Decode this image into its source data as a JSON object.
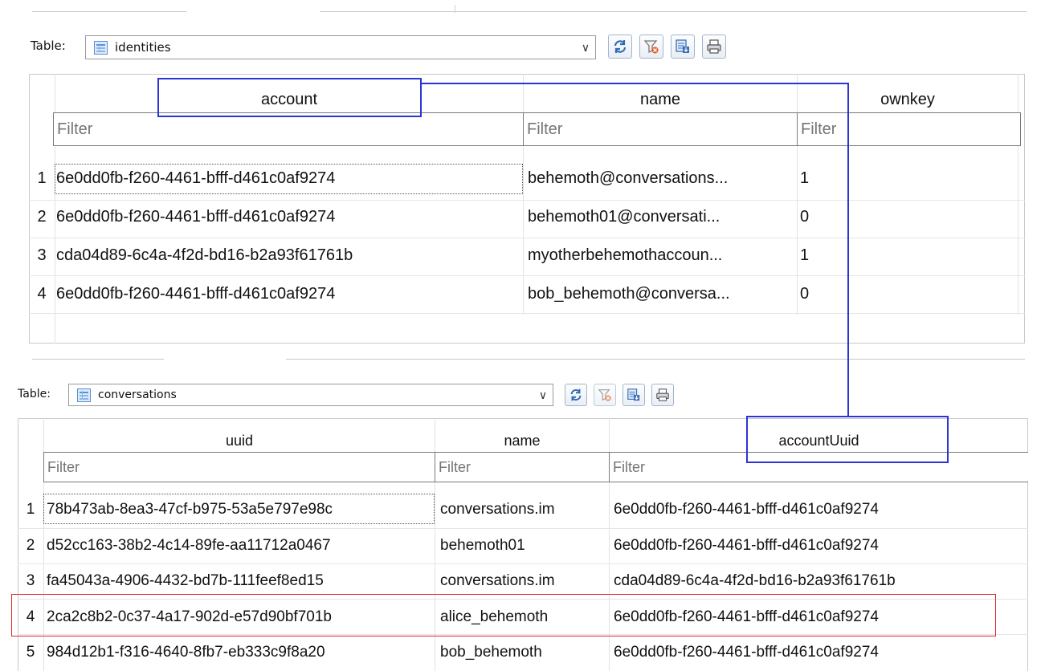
{
  "toolbar_label": "Table:",
  "identities": {
    "table_name": "identities",
    "columns": [
      "account",
      "name",
      "ownkey"
    ],
    "filter_placeholder": "Filter",
    "filter_placeholder_short": "Filter",
    "rows": [
      {
        "num": "1",
        "account": "6e0dd0fb-f260-4461-bfff-d461c0af9274",
        "name": "behemoth@conversations...",
        "ownkey": "1"
      },
      {
        "num": "2",
        "account": "6e0dd0fb-f260-4461-bfff-d461c0af9274",
        "name": "behemoth01@conversati...",
        "ownkey": "0"
      },
      {
        "num": "3",
        "account": "cda04d89-6c4a-4f2d-bd16-b2a93f61761b",
        "name": "myotherbehemothaccoun...",
        "ownkey": "1"
      },
      {
        "num": "4",
        "account": "6e0dd0fb-f260-4461-bfff-d461c0af9274",
        "name": "bob_behemoth@conversa...",
        "ownkey": "0"
      }
    ]
  },
  "conversations": {
    "table_name": "conversations",
    "columns": [
      "uuid",
      "name",
      "accountUuid"
    ],
    "filter_placeholder": "Filter",
    "rows": [
      {
        "num": "1",
        "uuid": "78b473ab-8ea3-47cf-b975-53a5e797e98c",
        "name": "conversations.im",
        "accountUuid": "6e0dd0fb-f260-4461-bfff-d461c0af9274"
      },
      {
        "num": "2",
        "uuid": "d52cc163-38b2-4c14-89fe-aa11712a0467",
        "name": "behemoth01",
        "accountUuid": "6e0dd0fb-f260-4461-bfff-d461c0af9274"
      },
      {
        "num": "3",
        "uuid": "fa45043a-4906-4432-bd7b-111feef8ed15",
        "name": "conversations.im",
        "accountUuid": "cda04d89-6c4a-4f2d-bd16-b2a93f61761b"
      },
      {
        "num": "4",
        "uuid": "2ca2c8b2-0c37-4a17-902d-e57d90bf701b",
        "name": "alice_behemoth",
        "accountUuid": "6e0dd0fb-f260-4461-bfff-d461c0af9274"
      },
      {
        "num": "5",
        "uuid": "984d12b1-f316-4640-8fb7-eb333c9f8a20",
        "name": "bob_behemoth",
        "accountUuid": "6e0dd0fb-f260-4461-bfff-d461c0af9274"
      }
    ]
  },
  "icons": [
    "refresh-icon",
    "clear-filters-icon",
    "save-table-icon",
    "print-icon",
    "table-icon",
    "chevron-down-icon"
  ],
  "colors": {
    "annotation_blue": "#2b34d6",
    "annotation_red": "#e0262b",
    "grid_border": "#c9c9c9"
  }
}
